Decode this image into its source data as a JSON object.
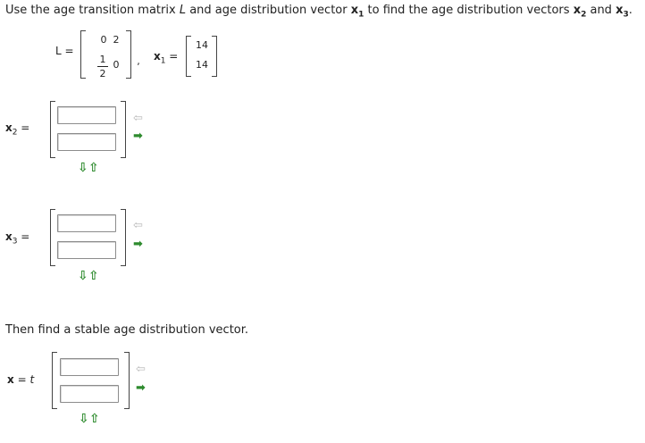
{
  "question": {
    "p1": "Use the age transition matrix ",
    "L": "L",
    "p2": " and age distribution vector ",
    "x": "x",
    "sub1": "1",
    "p3": " to find the age distribution vectors ",
    "sub2": "2",
    "p4": " and ",
    "sub3": "3",
    "p5": "."
  },
  "matrix_L": {
    "label": "L =",
    "row1": [
      "0",
      "2"
    ],
    "row2_frac_num": "1",
    "row2_frac_den": "2",
    "row2_c2": "0",
    "comma": ","
  },
  "vector_x1": {
    "label_x": "x",
    "label_sub": "1",
    "label_eq": " =",
    "values": [
      "14",
      "14"
    ]
  },
  "x2": {
    "label_x": "x",
    "label_sub": "2",
    "label_eq": " ="
  },
  "x3": {
    "label_x": "x",
    "label_sub": "3",
    "label_eq": " ="
  },
  "stable": {
    "prompt": "Then find a stable age distribution vector.",
    "label_x": "x",
    "label_eq": " = ",
    "label_t": "t"
  },
  "arrows": {
    "left": "⇦",
    "right": "➡",
    "down": "⇩",
    "up": "⇧"
  }
}
